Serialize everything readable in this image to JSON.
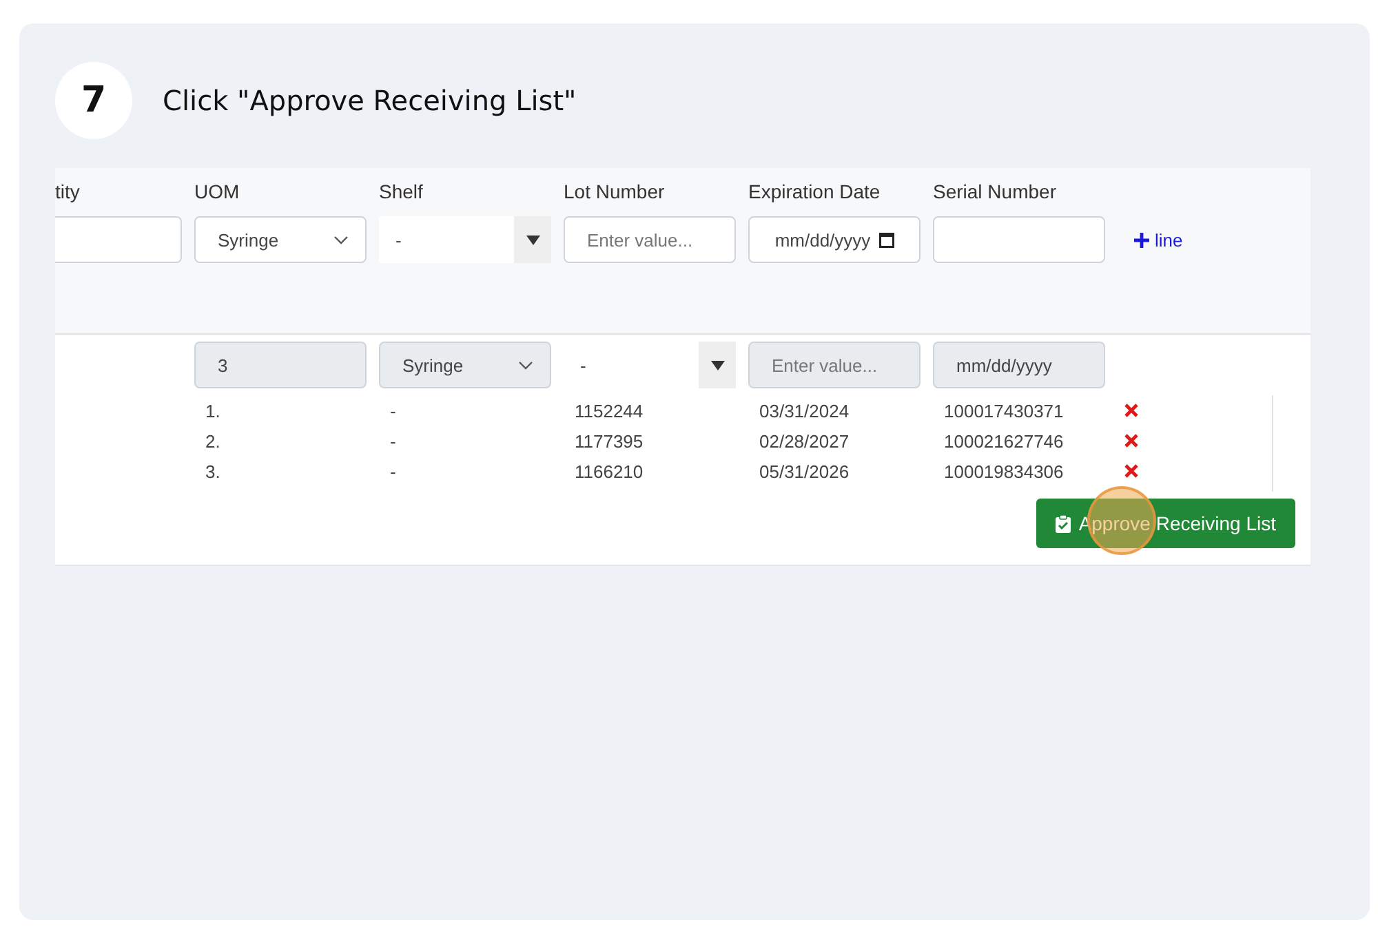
{
  "step": {
    "number": "7",
    "instruction": "Click \"Approve Receiving List\""
  },
  "columns": [
    "tity",
    "UOM",
    "Shelf",
    "Lot Number",
    "Expiration Date",
    "Serial Number"
  ],
  "entry_fields": [
    {
      "kind": "text",
      "disabled": false
    },
    {
      "kind": "select",
      "value": "Syringe",
      "disabled": false
    },
    {
      "kind": "combo",
      "value": "-",
      "disabled": false
    },
    {
      "kind": "text",
      "placeholder": "Enter value...",
      "disabled": false
    },
    {
      "kind": "date",
      "value": "mm/dd/yyyy",
      "disabled": false
    },
    {
      "kind": "text",
      "disabled": false
    }
  ],
  "add_line": {
    "label": "line"
  },
  "item_fields": [
    {
      "kind": "blank"
    },
    {
      "kind": "text",
      "value": "3",
      "disabled": true
    },
    {
      "kind": "select",
      "value": "Syringe",
      "disabled": true
    },
    {
      "kind": "combo",
      "value": "-",
      "disabled": false
    },
    {
      "kind": "text",
      "placeholder": "Enter value...",
      "disabled": true
    },
    {
      "kind": "text",
      "value": "mm/dd/yyyy",
      "disabled": true
    }
  ],
  "lines": [
    {
      "number": "1.",
      "shelf": "-",
      "lot": "1152244",
      "expiration": "03/31/2024",
      "serial": "100017430371"
    },
    {
      "number": "2.",
      "shelf": "-",
      "lot": "1177395",
      "expiration": "02/28/2027",
      "serial": "100021627746"
    },
    {
      "number": "3.",
      "shelf": "-",
      "lot": "1166210",
      "expiration": "05/31/2026",
      "serial": "100019834306"
    }
  ],
  "approve_button": {
    "label": "Approve Receiving List"
  }
}
